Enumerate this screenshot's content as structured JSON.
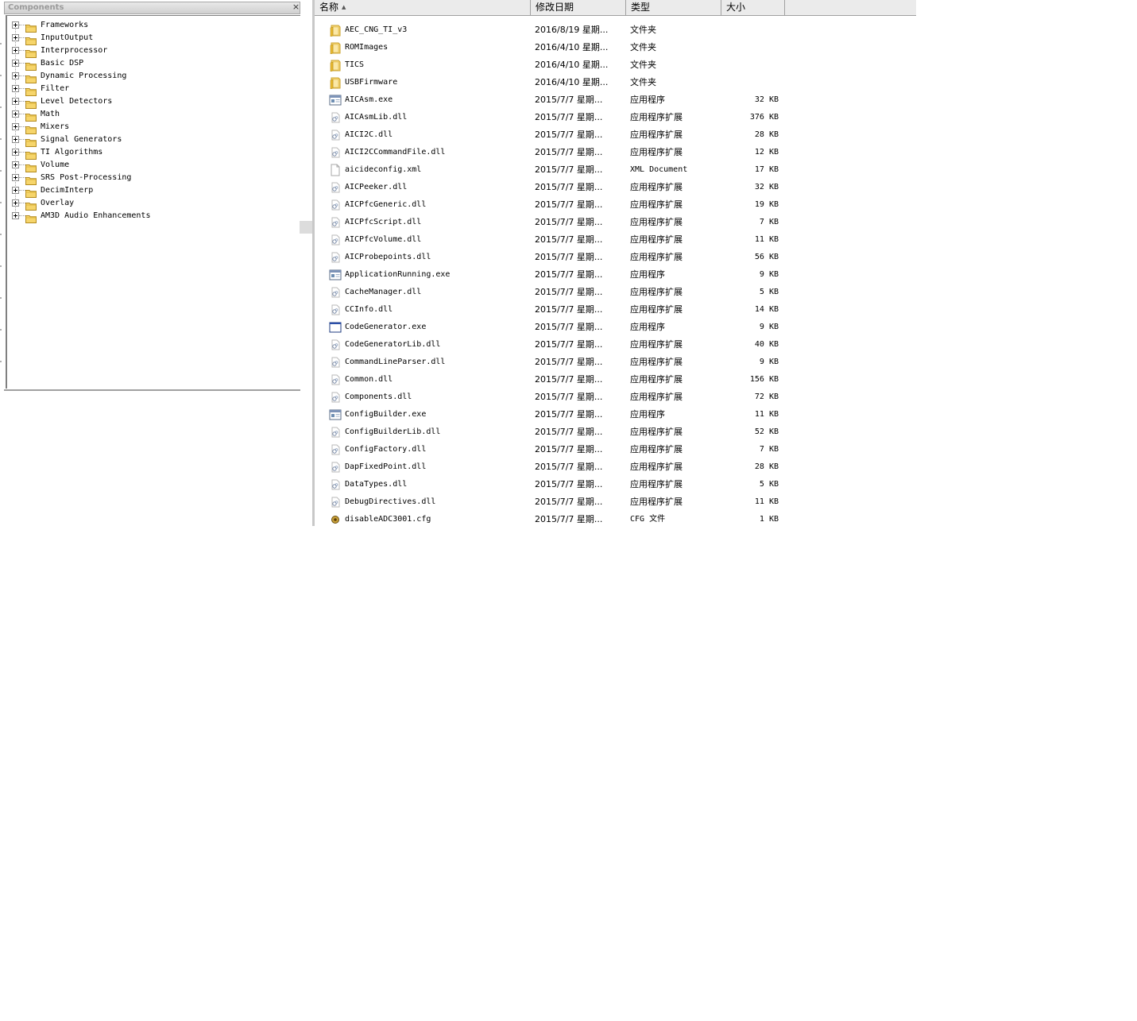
{
  "components_panel": {
    "title": "Components",
    "close_label": "×",
    "tree_items": [
      {
        "label": "Frameworks"
      },
      {
        "label": "InputOutput"
      },
      {
        "label": "Interprocessor"
      },
      {
        "label": "Basic DSP"
      },
      {
        "label": "Dynamic Processing"
      },
      {
        "label": "Filter"
      },
      {
        "label": "Level Detectors"
      },
      {
        "label": "Math"
      },
      {
        "label": "Mixers"
      },
      {
        "label": "Signal Generators"
      },
      {
        "label": "TI Algorithms"
      },
      {
        "label": "Volume"
      },
      {
        "label": "SRS Post-Processing"
      },
      {
        "label": "DecimInterp"
      },
      {
        "label": "Overlay"
      },
      {
        "label": "AM3D Audio Enhancements"
      }
    ]
  },
  "file_list": {
    "columns": {
      "name": "名称",
      "sort_indicator": "▲",
      "modified": "修改日期",
      "type": "类型",
      "size": "大小"
    },
    "files": [
      {
        "name": "AEC_CNG_TI_v3",
        "date": "2016/8/19 星期...",
        "type": "文件夹",
        "size": "",
        "icon": "folder-icon"
      },
      {
        "name": "ROMImages",
        "date": "2016/4/10 星期...",
        "type": "文件夹",
        "size": "",
        "icon": "folder-icon"
      },
      {
        "name": "TICS",
        "date": "2016/4/10 星期...",
        "type": "文件夹",
        "size": "",
        "icon": "folder-icon"
      },
      {
        "name": "USBFirmware",
        "date": "2016/4/10 星期...",
        "type": "文件夹",
        "size": "",
        "icon": "folder-icon"
      },
      {
        "name": "AICAsm.exe",
        "date": "2015/7/7 星期...",
        "type": "应用程序",
        "size": "32 KB",
        "icon": "exe-icon"
      },
      {
        "name": "AICAsmLib.dll",
        "date": "2015/7/7 星期...",
        "type": "应用程序扩展",
        "size": "376 KB",
        "icon": "dll-icon"
      },
      {
        "name": "AICI2C.dll",
        "date": "2015/7/7 星期...",
        "type": "应用程序扩展",
        "size": "28 KB",
        "icon": "dll-icon"
      },
      {
        "name": "AICI2CCommandFile.dll",
        "date": "2015/7/7 星期...",
        "type": "应用程序扩展",
        "size": "12 KB",
        "icon": "dll-icon"
      },
      {
        "name": "aicideconfig.xml",
        "date": "2015/7/7 星期...",
        "type": "XML Document",
        "size": "17 KB",
        "icon": "xml-icon"
      },
      {
        "name": "AICPeeker.dll",
        "date": "2015/7/7 星期...",
        "type": "应用程序扩展",
        "size": "32 KB",
        "icon": "dll-icon"
      },
      {
        "name": "AICPfcGeneric.dll",
        "date": "2015/7/7 星期...",
        "type": "应用程序扩展",
        "size": "19 KB",
        "icon": "dll-icon"
      },
      {
        "name": "AICPfcScript.dll",
        "date": "2015/7/7 星期...",
        "type": "应用程序扩展",
        "size": "7 KB",
        "icon": "dll-icon"
      },
      {
        "name": "AICPfcVolume.dll",
        "date": "2015/7/7 星期...",
        "type": "应用程序扩展",
        "size": "11 KB",
        "icon": "dll-icon"
      },
      {
        "name": "AICProbepoints.dll",
        "date": "2015/7/7 星期...",
        "type": "应用程序扩展",
        "size": "56 KB",
        "icon": "dll-icon"
      },
      {
        "name": "ApplicationRunning.exe",
        "date": "2015/7/7 星期...",
        "type": "应用程序",
        "size": "9 KB",
        "icon": "exe-icon"
      },
      {
        "name": "CacheManager.dll",
        "date": "2015/7/7 星期...",
        "type": "应用程序扩展",
        "size": "5 KB",
        "icon": "dll-icon"
      },
      {
        "name": "CCInfo.dll",
        "date": "2015/7/7 星期...",
        "type": "应用程序扩展",
        "size": "14 KB",
        "icon": "dll-icon"
      },
      {
        "name": "CodeGenerator.exe",
        "date": "2015/7/7 星期...",
        "type": "应用程序",
        "size": "9 KB",
        "icon": "window-exe-icon"
      },
      {
        "name": "CodeGeneratorLib.dll",
        "date": "2015/7/7 星期...",
        "type": "应用程序扩展",
        "size": "40 KB",
        "icon": "dll-icon"
      },
      {
        "name": "CommandLineParser.dll",
        "date": "2015/7/7 星期...",
        "type": "应用程序扩展",
        "size": "9 KB",
        "icon": "dll-icon"
      },
      {
        "name": "Common.dll",
        "date": "2015/7/7 星期...",
        "type": "应用程序扩展",
        "size": "156 KB",
        "icon": "dll-icon"
      },
      {
        "name": "Components.dll",
        "date": "2015/7/7 星期...",
        "type": "应用程序扩展",
        "size": "72 KB",
        "icon": "dll-icon"
      },
      {
        "name": "ConfigBuilder.exe",
        "date": "2015/7/7 星期...",
        "type": "应用程序",
        "size": "11 KB",
        "icon": "exe-icon"
      },
      {
        "name": "ConfigBuilderLib.dll",
        "date": "2015/7/7 星期...",
        "type": "应用程序扩展",
        "size": "52 KB",
        "icon": "dll-icon"
      },
      {
        "name": "ConfigFactory.dll",
        "date": "2015/7/7 星期...",
        "type": "应用程序扩展",
        "size": "7 KB",
        "icon": "dll-icon"
      },
      {
        "name": "DapFixedPoint.dll",
        "date": "2015/7/7 星期...",
        "type": "应用程序扩展",
        "size": "28 KB",
        "icon": "dll-icon"
      },
      {
        "name": "DataTypes.dll",
        "date": "2015/7/7 星期...",
        "type": "应用程序扩展",
        "size": "5 KB",
        "icon": "dll-icon"
      },
      {
        "name": "DebugDirectives.dll",
        "date": "2015/7/7 星期...",
        "type": "应用程序扩展",
        "size": "11 KB",
        "icon": "dll-icon"
      },
      {
        "name": "disableADC3001.cfg",
        "date": "2015/7/7 星期...",
        "type": "CFG 文件",
        "size": "1 KB",
        "icon": "cfg-icon"
      }
    ]
  },
  "colors": {
    "folder": "#f2c94c",
    "folder_dark": "#d9a520",
    "header_bg": "#ebebeb",
    "border": "#a0a0a0"
  }
}
